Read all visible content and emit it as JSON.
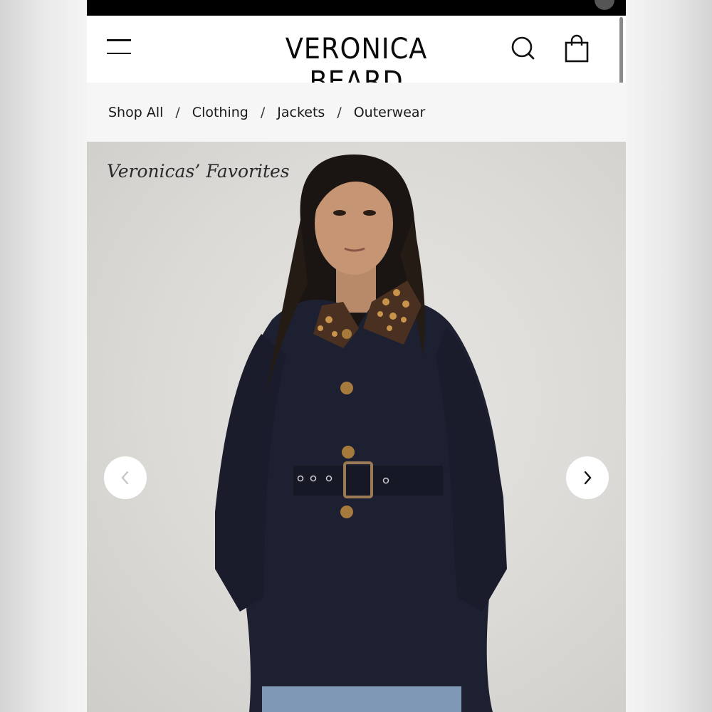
{
  "header": {
    "brand": "VERONICA BEARD",
    "menu_icon": "hamburger-menu-icon",
    "search_icon": "search-icon",
    "bag_icon": "shopping-bag-icon"
  },
  "breadcrumb": {
    "items": [
      "Shop All",
      "Clothing",
      "Jackets",
      "Outerwear"
    ],
    "separator": "/"
  },
  "hero": {
    "caption": "Veronicas’ Favorites",
    "prev_icon": "chevron-left-icon",
    "next_icon": "chevron-right-icon"
  },
  "colors": {
    "text": "#111111",
    "breadcrumb_bg": "#f6f6f6",
    "hero_bg": "#dcdad6",
    "coat": "#1d2030",
    "gold": "#a57a3c"
  }
}
